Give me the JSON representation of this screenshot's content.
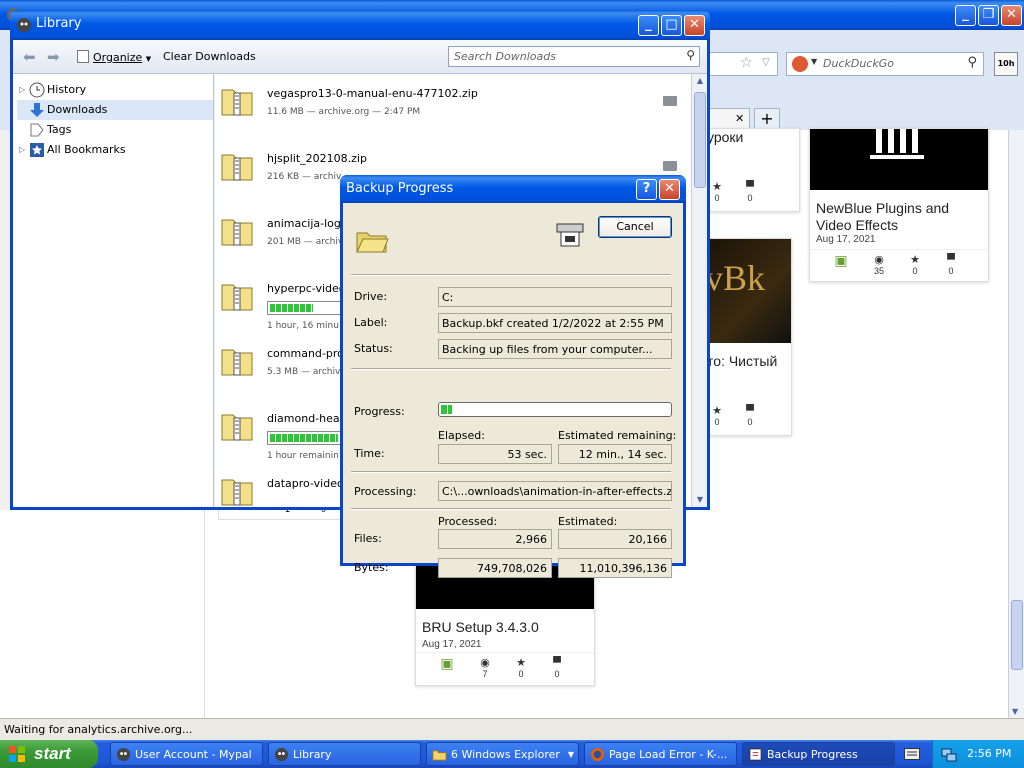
{
  "firefox": {
    "search_placeholder": "DuckDuckGo",
    "badge_10h": "10h",
    "new_tab": "+",
    "status_text": "Waiting for analytics.archive.org...",
    "cards": [
      {
        "title": "урoки",
        "stats": {
          "views": "",
          "favs": "0",
          "reviews": "0"
        }
      },
      {
        "title": "NewBlue Plugins and Video Effects",
        "date": "Aug 17, 2021",
        "stats": {
          "views": "35",
          "favs": "0",
          "reviews": "0"
        }
      },
      {
        "title": "то: Чистый",
        "stats": {
          "favs": "0",
          "reviews": "0"
        }
      },
      {
        "title": "BRU Setup 3.4.3.0",
        "date": "Aug 17, 2021",
        "stats": {
          "views": "7",
          "favs": "0",
          "reviews": "0"
        }
      }
    ],
    "partial_card_stats": {
      "a": "1",
      "b": "0"
    }
  },
  "library": {
    "title": "Library",
    "organize": "Organize",
    "clear_downloads": "Clear Downloads",
    "search_placeholder": "Search Downloads",
    "tree": [
      {
        "label": "History"
      },
      {
        "label": "Downloads"
      },
      {
        "label": "Tags"
      },
      {
        "label": "All Bookmarks"
      }
    ],
    "downloads": [
      {
        "name": "vegaspro13-0-manual-enu-477102.zip",
        "meta": "11.6 MB — archive.org — 2:47 PM"
      },
      {
        "name": "hjsplit_202108.zip",
        "meta": "216 KB — archiv"
      },
      {
        "name": "animacija-logo-",
        "meta": "201 MB — archiv"
      },
      {
        "name": "hyperpc-videos",
        "meta": "1 hour, 16 minu",
        "progress": 0.62
      },
      {
        "name": "command-prom",
        "meta": "5.3 MB — archiv"
      },
      {
        "name": "diamond-heart",
        "meta": "1 hour remainin",
        "progress": 0.97
      },
      {
        "name": "datapro-videos"
      }
    ]
  },
  "backup": {
    "title": "Backup Progress",
    "cancel": "Cancel",
    "labels": {
      "drive": "Drive:",
      "label": "Label:",
      "status": "Status:",
      "progress": "Progress:",
      "time": "Time:",
      "processing": "Processing:",
      "files": "Files:",
      "bytes": "Bytes:"
    },
    "headers": {
      "elapsed": "Elapsed:",
      "estimated_remaining": "Estimated remaining:",
      "processed": "Processed:",
      "estimated": "Estimated:"
    },
    "drive": "C:",
    "label": "Backup.bkf created 1/2/2022 at 2:55 PM",
    "status": "Backing up files from your computer...",
    "progress": 0.05,
    "elapsed": "53 sec.",
    "remaining": "12 min., 14 sec.",
    "processing": "C:\\...ownloads\\animation-in-after-effects.zip.part",
    "files_processed": "2,966",
    "files_estimated": "20,166",
    "bytes_processed": "749,708,026",
    "bytes_estimated": "11,010,396,136"
  },
  "taskbar": {
    "start": "start",
    "tasks": [
      {
        "label": "User Account - Mypal"
      },
      {
        "label": "Library"
      },
      {
        "label": "6 Windows Explorer"
      },
      {
        "label": "Page Load Error - K-..."
      },
      {
        "label": "Backup Progress"
      }
    ],
    "clock": "2:56 PM"
  },
  "colors": {
    "xp_blue": "#0058e6",
    "progress_green": "#2fc53a",
    "dialog_bg": "#ece9d8",
    "start_green": "#3b9a36"
  }
}
